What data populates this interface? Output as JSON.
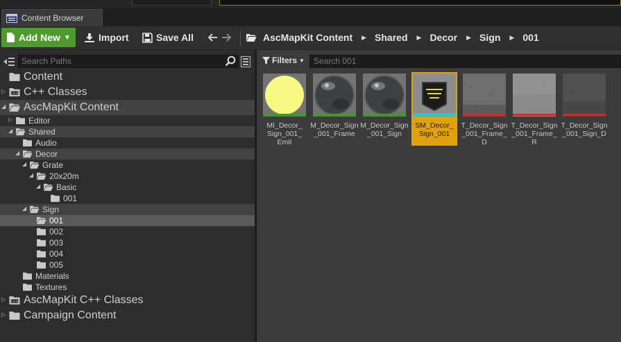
{
  "tab": {
    "title": "Content Browser"
  },
  "toolbar": {
    "add_new": "Add New",
    "import": "Import",
    "save_all": "Save All"
  },
  "breadcrumbs": [
    "AscMapKit Content",
    "Shared",
    "Decor",
    "Sign",
    "001"
  ],
  "left": {
    "search_placeholder": "Search Paths",
    "tree": [
      {
        "label": "Content",
        "depth": 0,
        "big": true,
        "expander": "",
        "state": ""
      },
      {
        "label": "C++ Classes",
        "depth": 0,
        "big": true,
        "expander": "collapsed",
        "icon": "cpp",
        "state": ""
      },
      {
        "label": "AscMapKit Content",
        "depth": 0,
        "big": true,
        "expander": "expanded",
        "state": "highlight"
      },
      {
        "label": "Editor",
        "depth": 1,
        "expander": "collapsed",
        "state": ""
      },
      {
        "label": "Shared",
        "depth": 1,
        "expander": "expanded",
        "state": "highlight"
      },
      {
        "label": "Audio",
        "depth": 2,
        "expander": "",
        "state": ""
      },
      {
        "label": "Decor",
        "depth": 2,
        "expander": "expanded",
        "state": "highlight"
      },
      {
        "label": "Grate",
        "depth": 3,
        "expander": "expanded",
        "state": ""
      },
      {
        "label": "20x20m",
        "depth": 4,
        "expander": "expanded",
        "state": ""
      },
      {
        "label": "Basic",
        "depth": 5,
        "expander": "expanded",
        "state": ""
      },
      {
        "label": "001",
        "depth": 6,
        "expander": "",
        "state": ""
      },
      {
        "label": "Sign",
        "depth": 3,
        "expander": "expanded",
        "state": "highlight"
      },
      {
        "label": "001",
        "depth": 4,
        "expander": "",
        "state": "selected"
      },
      {
        "label": "002",
        "depth": 4,
        "expander": "",
        "state": ""
      },
      {
        "label": "003",
        "depth": 4,
        "expander": "",
        "state": ""
      },
      {
        "label": "004",
        "depth": 4,
        "expander": "",
        "state": ""
      },
      {
        "label": "005",
        "depth": 4,
        "expander": "",
        "state": ""
      },
      {
        "label": "Materials",
        "depth": 2,
        "expander": "",
        "state": ""
      },
      {
        "label": "Textures",
        "depth": 2,
        "expander": "",
        "state": ""
      },
      {
        "label": "AscMapKit C++ Classes",
        "depth": 0,
        "big": true,
        "expander": "collapsed",
        "icon": "cpp",
        "state": ""
      },
      {
        "label": "Campaign Content",
        "depth": 0,
        "big": true,
        "expander": "collapsed",
        "state": ""
      }
    ]
  },
  "right": {
    "filters_label": "Filters",
    "search_placeholder": "Search 001",
    "assets": [
      {
        "name": "MI_Decor_Sign_001_Emit",
        "lines": [
          "MI_Decor_",
          "Sign_001_",
          "Emit"
        ],
        "thumb": "yellow-sphere",
        "bar": "#3f9a2c",
        "selected": false
      },
      {
        "name": "M_Decor_Sign_001_Frame",
        "lines": [
          "M_Decor_Sign",
          "_001_Frame"
        ],
        "thumb": "metal-sphere",
        "bar": "#3f9a2c",
        "selected": false
      },
      {
        "name": "M_Decor_Sign_001_Sign",
        "lines": [
          "M_Decor_Sign",
          "_001_Sign"
        ],
        "thumb": "metal-sphere",
        "bar": "#3f9a2c",
        "selected": false
      },
      {
        "name": "SM_Decor_Sign_001",
        "lines": [
          "SM_Decor_",
          "Sign_001"
        ],
        "thumb": "sign-mesh",
        "bar": "#27c9e6",
        "selected": true
      },
      {
        "name": "T_Decor_Sign_001_Frame_D",
        "lines": [
          "T_Decor_Sign",
          "_001_Frame_",
          "D"
        ],
        "thumb": "gray-texture",
        "bar": "#c4312a",
        "selected": false
      },
      {
        "name": "T_Decor_Sign_001_Frame_R",
        "lines": [
          "T_Decor_Sign",
          "_001_Frame_",
          "R"
        ],
        "thumb": "light-texture",
        "bar": "#c4312a",
        "selected": false
      },
      {
        "name": "T_Decor_Sign_001_Sign_D",
        "lines": [
          "T_Decor_Sign",
          "_001_Sign_D"
        ],
        "thumb": "dark-texture",
        "bar": "#c4312a",
        "selected": false
      }
    ]
  },
  "colors": {
    "add_new_green": "#4f9a2e",
    "selection_orange": "#e0a110",
    "material_bar": "#3f9a2c",
    "mesh_bar": "#27c9e6",
    "texture_bar": "#c4312a"
  }
}
